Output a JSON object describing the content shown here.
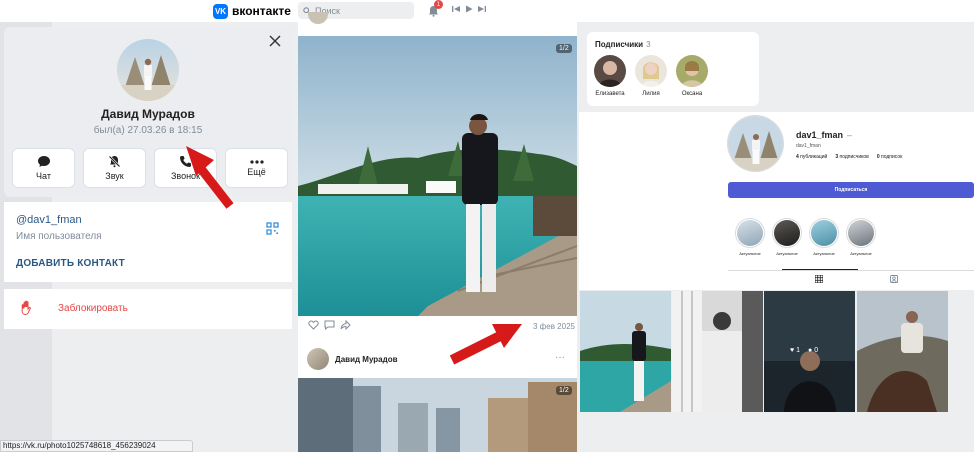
{
  "header": {
    "logo_mark": "VK",
    "logo_text": "вконтакте",
    "search_placeholder": "Поиск",
    "notifications_count": "1"
  },
  "profile": {
    "name": "Давид Мурадов",
    "last_seen": "был(а) 27.03.26 в 18:15",
    "actions": [
      {
        "label": "Чат",
        "icon": "chat-bubble-icon"
      },
      {
        "label": "Звук",
        "icon": "bell-off-icon"
      },
      {
        "label": "Звонок",
        "icon": "phone-icon"
      },
      {
        "label": "Ещё",
        "icon": "more-dots-icon"
      }
    ],
    "username": "@dav1_fman",
    "username_caption": "Имя пользователя",
    "add_contact": "ДОБАВИТЬ КОНТАКТ",
    "block": "Заблокировать"
  },
  "feed": {
    "photo1_counter": "1/2",
    "post_date": "3 фев 2025",
    "author_name": "Давид Мурадов",
    "more": "···",
    "photo2_counter": "1/2"
  },
  "subscribers": {
    "title": "Подписчики",
    "count": "3",
    "people": [
      "Елизавета",
      "Лилия",
      "Оксана"
    ]
  },
  "instagram": {
    "username": "dav1_fman",
    "username_sub": "dav1_fman",
    "posts": "4",
    "posts_label": "публикаций",
    "followers": "3",
    "followers_label": "подписчиков",
    "following": "0",
    "following_label": "подписок",
    "follow_button": "Подписаться",
    "highlights": [
      "Актуальное",
      "Актуальное",
      "Актуальное",
      "Актуальное"
    ],
    "grid_likes": "1",
    "grid_comments": "0"
  },
  "statusbar": {
    "url": "https://vk.ru/photo1025748618_456239024"
  },
  "colors": {
    "accent": "#0077ff",
    "link": "#2a5885",
    "danger": "#e64646",
    "follow": "#4f5bd5"
  }
}
